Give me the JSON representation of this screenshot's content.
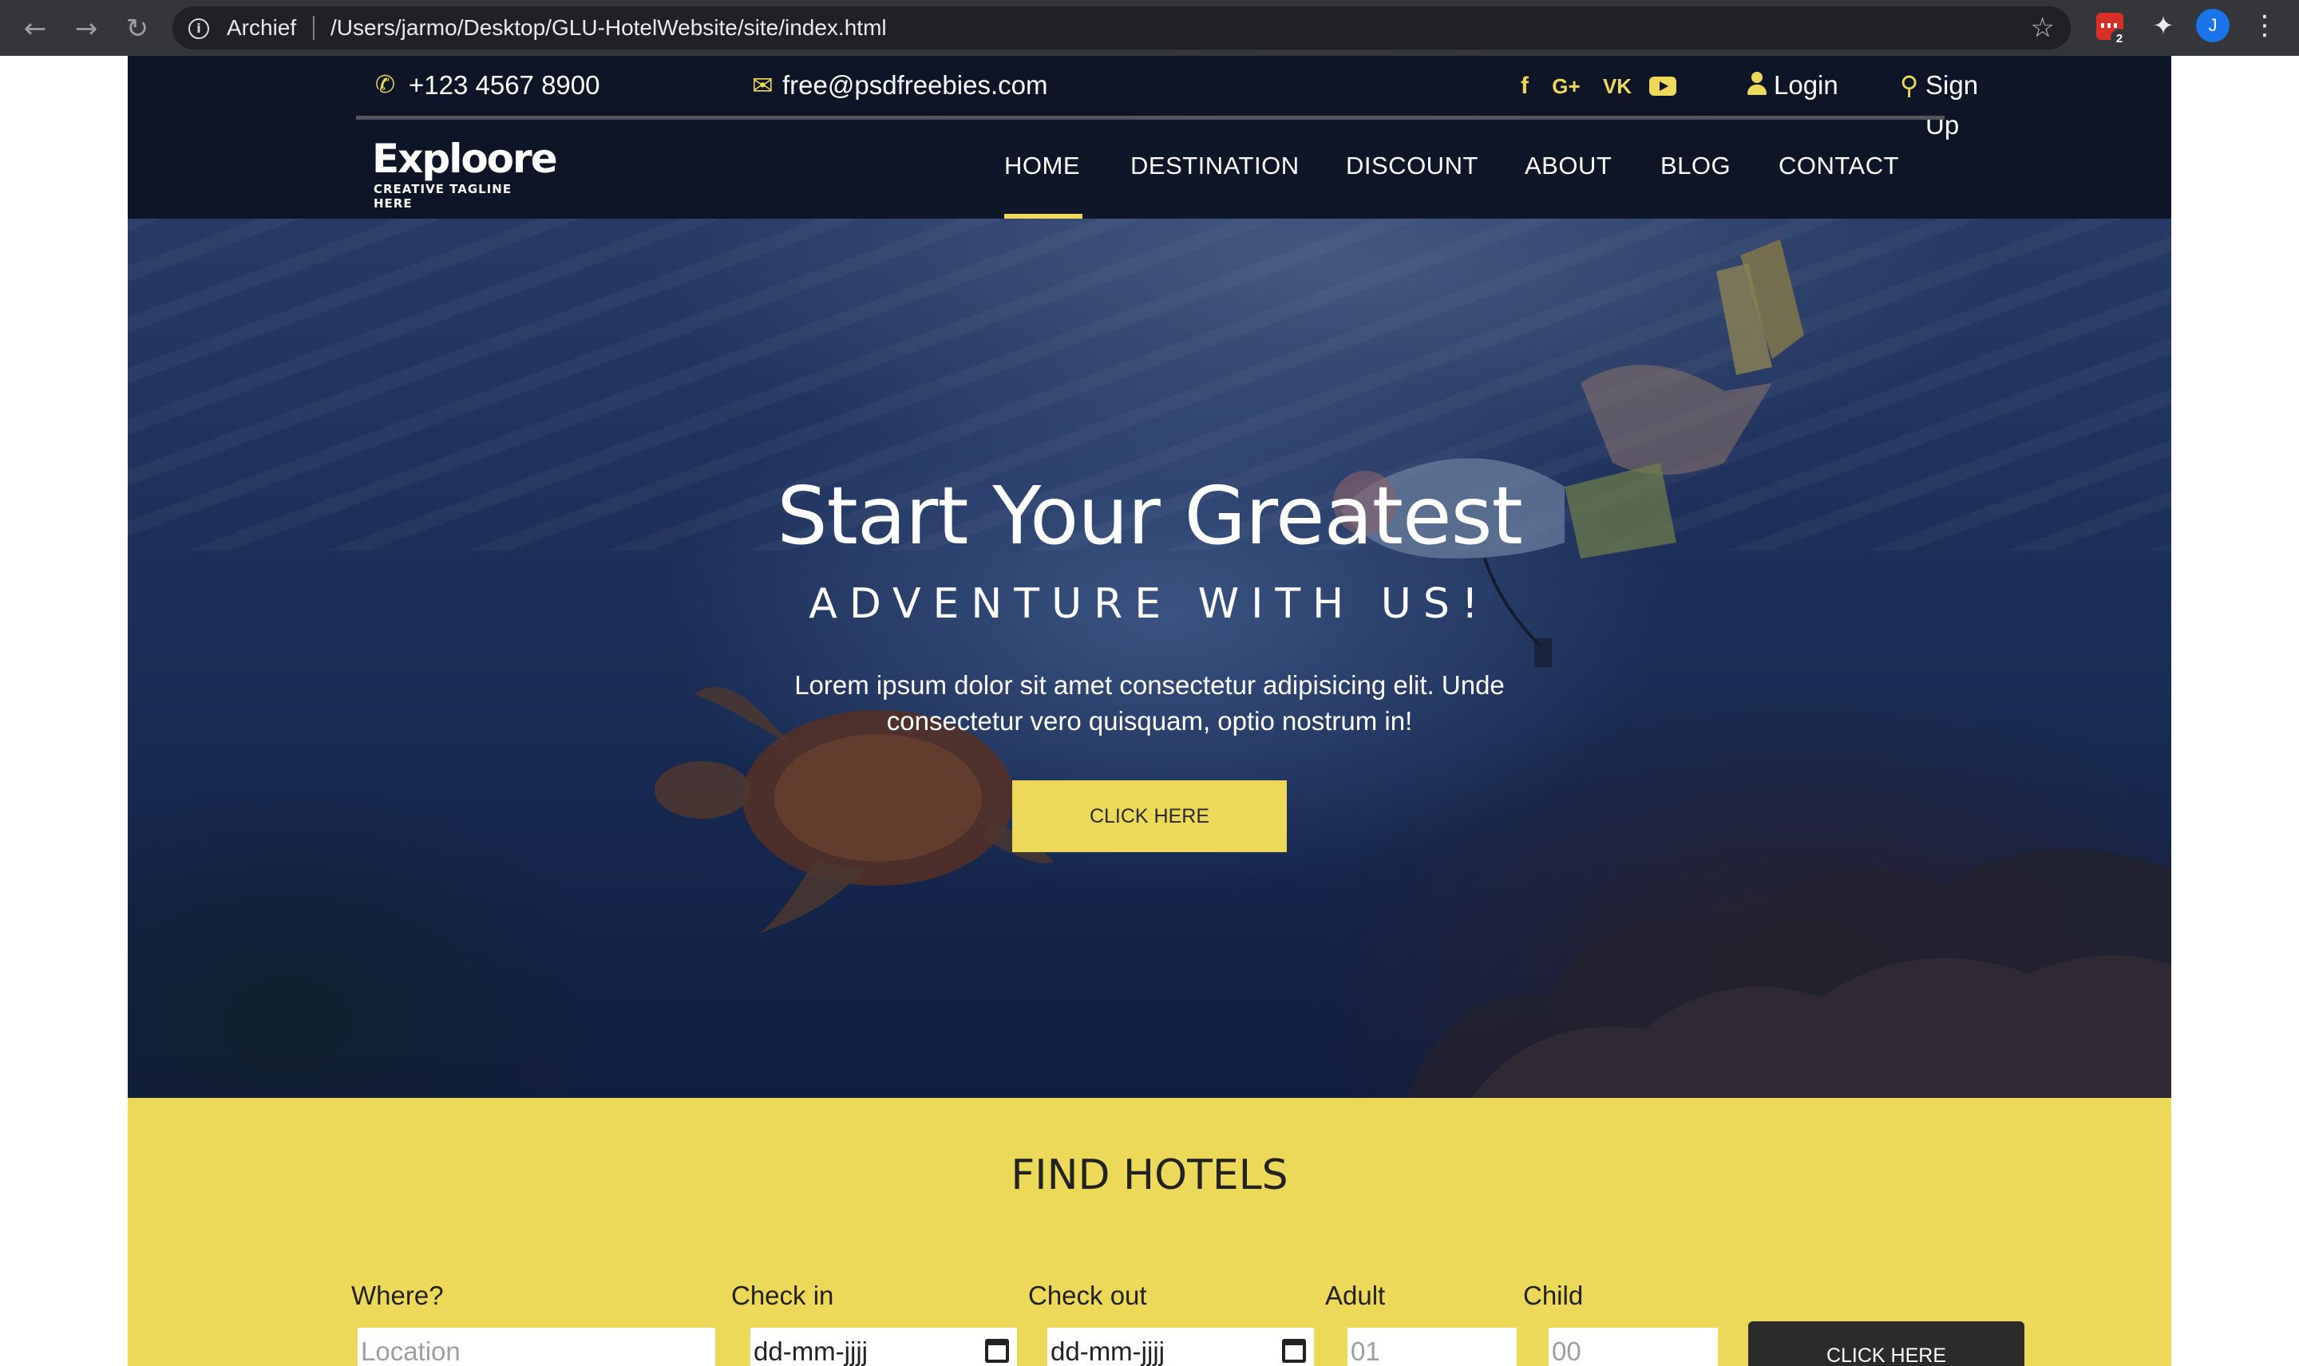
{
  "browser": {
    "site_label": "Archief",
    "url": "/Users/jarmo/Desktop/GLU-HotelWebsite/site/index.html",
    "extension_badge": "2",
    "profile_initial": "J"
  },
  "topbar": {
    "phone": "+123 4567 8900",
    "email": "free@psdfreebies.com",
    "social": [
      "facebook-icon",
      "google-plus-icon",
      "vk-icon",
      "youtube-icon"
    ],
    "facebook_glyph": "f",
    "google_glyph": "G+",
    "vk_glyph": "VK",
    "login": "Login",
    "signup": "Sign Up"
  },
  "logo": {
    "name": "Exploore",
    "tagline": "CREATIVE TAGLINE HERE"
  },
  "nav": {
    "items": [
      "HOME",
      "DESTINATION",
      "DISCOUNT",
      "ABOUT",
      "BLOG",
      "CONTACT"
    ],
    "active": "HOME"
  },
  "hero": {
    "title": "Start Your Greatest",
    "subtitle": "ADVENTURE WITH US!",
    "text": "Lorem ipsum dolor sit amet consectetur adipisicing elit. Unde consectetur vero quisquam, optio nostrum in!",
    "cta": "CLICK HERE"
  },
  "find_hotels": {
    "title": "FIND HOTELS",
    "fields": {
      "where": {
        "label": "Where?",
        "placeholder": "Location"
      },
      "check_in": {
        "label": "Check in",
        "value": "dd-mm-jjjj"
      },
      "check_out": {
        "label": "Check out",
        "value": "dd-mm-jjjj"
      },
      "adult": {
        "label": "Adult",
        "placeholder": "01"
      },
      "child": {
        "label": "Child",
        "placeholder": "00"
      }
    },
    "submit": "CLICK HERE"
  },
  "colors": {
    "accent": "#ecd95a",
    "header_bg": "#0e1424",
    "chrome_bg": "#35363a",
    "button_dark": "#2b2b2b"
  }
}
